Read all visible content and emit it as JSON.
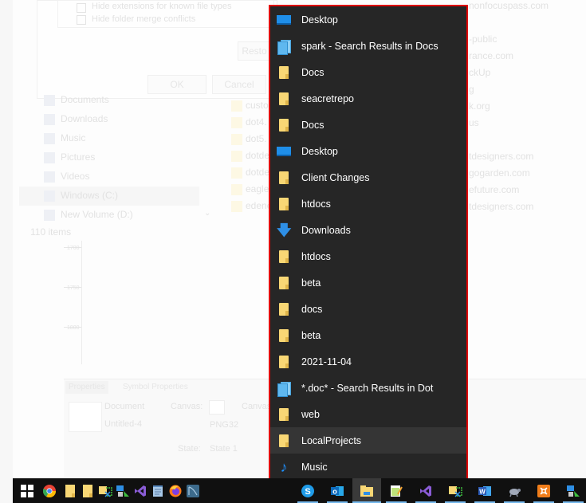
{
  "background": {
    "dialog": {
      "options": [
        {
          "label": "Hide extensions for known file types",
          "checked": false
        },
        {
          "label": "Hide folder merge conflicts",
          "checked": true
        }
      ],
      "restore_button": "Resto",
      "ok_button": "OK",
      "cancel_button": "Cancel"
    },
    "navigation": [
      {
        "label": "Documents",
        "icon": "documents-icon"
      },
      {
        "label": "Downloads",
        "icon": "downloads-icon"
      },
      {
        "label": "Music",
        "icon": "music-icon"
      },
      {
        "label": "Pictures",
        "icon": "pictures-icon"
      },
      {
        "label": "Videos",
        "icon": "videos-icon"
      },
      {
        "label": "Windows (C:)",
        "icon": "drive-icon",
        "selected": true
      },
      {
        "label": "New Volume (D:)",
        "icon": "drive-icon"
      }
    ],
    "status_bar": "110 items",
    "files": [
      "custo",
      "dot4.",
      "dot5.",
      "dotde",
      "dotde",
      "eagle",
      "edene"
    ],
    "files_right": [
      "nonfocuspass.com",
      "-public",
      "rance.com",
      "ckUp",
      "g",
      "k.org",
      "us",
      "tdesigners.com",
      "gogarden.com",
      "efuture.com",
      "tdesigners.com"
    ],
    "ruler_labels": [
      "1700",
      "1750",
      "1800"
    ],
    "editor_panel": {
      "tabs": [
        "Properties",
        "Symbol Properties"
      ],
      "doc_type": "Document",
      "doc_name": "Untitled-4",
      "canvas_label": "Canvas:",
      "canvas_label2": "Canvas",
      "format": "PNG32",
      "state_label": "State:",
      "state_value": "State 1"
    }
  },
  "jumplist": {
    "items": [
      {
        "label": "Desktop",
        "icon": "desktop"
      },
      {
        "label": "spark - Search Results in Docs",
        "icon": "search"
      },
      {
        "label": "Docs",
        "icon": "folder"
      },
      {
        "label": "seacretrepo",
        "icon": "folder"
      },
      {
        "label": "Docs",
        "icon": "folder"
      },
      {
        "label": "Desktop",
        "icon": "desktop"
      },
      {
        "label": "Client Changes",
        "icon": "folder"
      },
      {
        "label": "htdocs",
        "icon": "folder"
      },
      {
        "label": "Downloads",
        "icon": "download"
      },
      {
        "label": "htdocs",
        "icon": "folder"
      },
      {
        "label": "beta",
        "icon": "folder"
      },
      {
        "label": "docs",
        "icon": "folder"
      },
      {
        "label": "beta",
        "icon": "folder"
      },
      {
        "label": "2021-11-04",
        "icon": "folder"
      },
      {
        "label": "*.doc* - Search Results in Dot",
        "icon": "search"
      },
      {
        "label": "web",
        "icon": "folder"
      },
      {
        "label": "LocalProjects",
        "icon": "folder",
        "hovered": true
      },
      {
        "label": "Music",
        "icon": "music"
      }
    ],
    "glyphs": {
      "download": "🡇",
      "music": "♪"
    }
  },
  "taskbar": {
    "left": [
      {
        "name": "start",
        "color": "#ffffff"
      },
      {
        "name": "chrome",
        "color": "#e94235"
      },
      {
        "name": "file-explorer-folder",
        "color": "#f8d775"
      },
      {
        "name": "file-explorer-folder-2",
        "color": "#f8d775"
      },
      {
        "name": "snipping-tool",
        "color": "#f8d775"
      },
      {
        "name": "remote-desktop",
        "color": "#2e8fe6"
      },
      {
        "name": "visual-studio",
        "color": "#8a5cd6"
      },
      {
        "name": "notepad",
        "color": "#a8c8e8"
      },
      {
        "name": "firefox",
        "color": "#ff7a1a"
      },
      {
        "name": "mysql-workbench",
        "color": "#3d6b8c"
      }
    ],
    "right": [
      {
        "name": "skype",
        "color": "#1f9be8",
        "glyph": "S",
        "running": true
      },
      {
        "name": "outlook",
        "color": "#0f6cbd",
        "glyph": "o",
        "running": true
      },
      {
        "name": "file-explorer",
        "color": "#f8d775",
        "running": true,
        "active": true
      },
      {
        "name": "notepad-plus",
        "color": "#bde27a",
        "running": true
      },
      {
        "name": "visual-studio",
        "color": "#8a5cd6",
        "running": true
      },
      {
        "name": "snipping-tool",
        "color": "#f8d775",
        "running": true
      },
      {
        "name": "word",
        "color": "#2b5bb8",
        "glyph": "W",
        "running": true
      },
      {
        "name": "tortoise",
        "color": "#a0a8b8",
        "running": true
      },
      {
        "name": "xampp",
        "color": "#f07d1a",
        "running": true
      },
      {
        "name": "remote-desktop",
        "color": "#2e8fe6",
        "running": true
      }
    ]
  }
}
